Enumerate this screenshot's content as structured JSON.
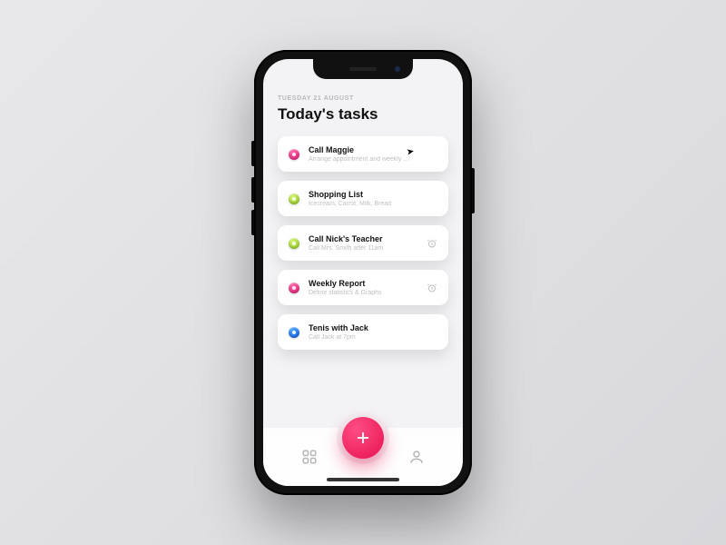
{
  "header": {
    "date": "TUESDAY 21 AUGUST",
    "title": "Today's tasks"
  },
  "tasks": [
    {
      "title": "Call Maggie",
      "subtitle": "Arrange appointment and weekly …",
      "color": "pink",
      "alarm": false
    },
    {
      "title": "Shopping List",
      "subtitle": "Icecream, Carrot, Milk, Bread",
      "color": "green",
      "alarm": false
    },
    {
      "title": "Call Nick's Teacher",
      "subtitle": "Call Mrs. Smith after 11am",
      "color": "green",
      "alarm": true
    },
    {
      "title": "Weekly Report",
      "subtitle": "Define statistics & Graphs",
      "color": "pink",
      "alarm": true
    },
    {
      "title": "Tenis with Jack",
      "subtitle": "Call Jack at 7pm",
      "color": "blue",
      "alarm": false
    }
  ],
  "nav": {
    "grid_icon": "grid-icon",
    "profile_icon": "profile-icon",
    "add_icon": "plus-icon"
  }
}
